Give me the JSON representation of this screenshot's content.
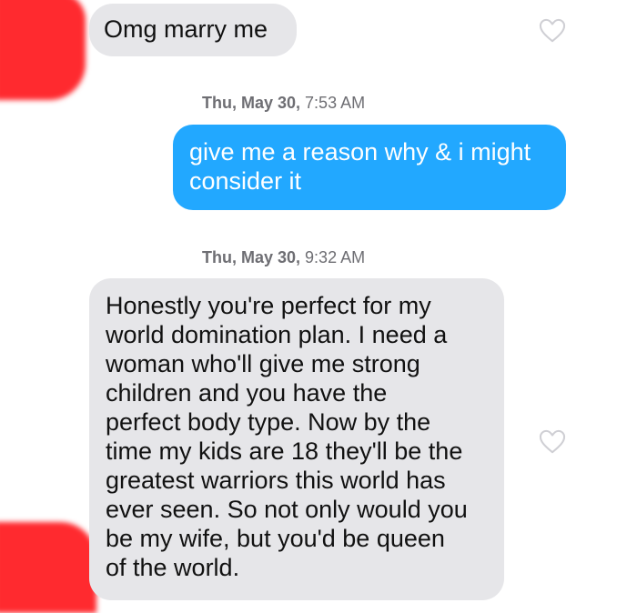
{
  "thread": {
    "messages": [
      {
        "id": "msg1",
        "direction": "incoming",
        "lines": [
          "Omg marry me"
        ]
      },
      {
        "id": "msg2",
        "direction": "outgoing",
        "lines": [
          "give me a reason why & i might",
          "consider it"
        ]
      },
      {
        "id": "msg3",
        "direction": "incoming",
        "lines": [
          "Honestly you're perfect for my",
          "world domination plan. I need a",
          "woman who'll give me strong",
          "children and you have the",
          "perfect body type. Now by the",
          "time my kids are 18 they'll be the",
          "greatest warriors this world has",
          "ever seen. So not only would you",
          "be my wife, but you'd be queen",
          "of the world."
        ]
      }
    ],
    "timestamps": [
      {
        "day": "Thu, May 30,",
        "time": "7:53 AM"
      },
      {
        "day": "Thu, May 30,",
        "time": "9:32 AM"
      }
    ]
  },
  "icons": {
    "like": "heart-outline-icon"
  },
  "colors": {
    "outgoing_bubble": "#22a8ff",
    "incoming_bubble": "#e6e6e9",
    "redaction": "#ff2a2f"
  }
}
